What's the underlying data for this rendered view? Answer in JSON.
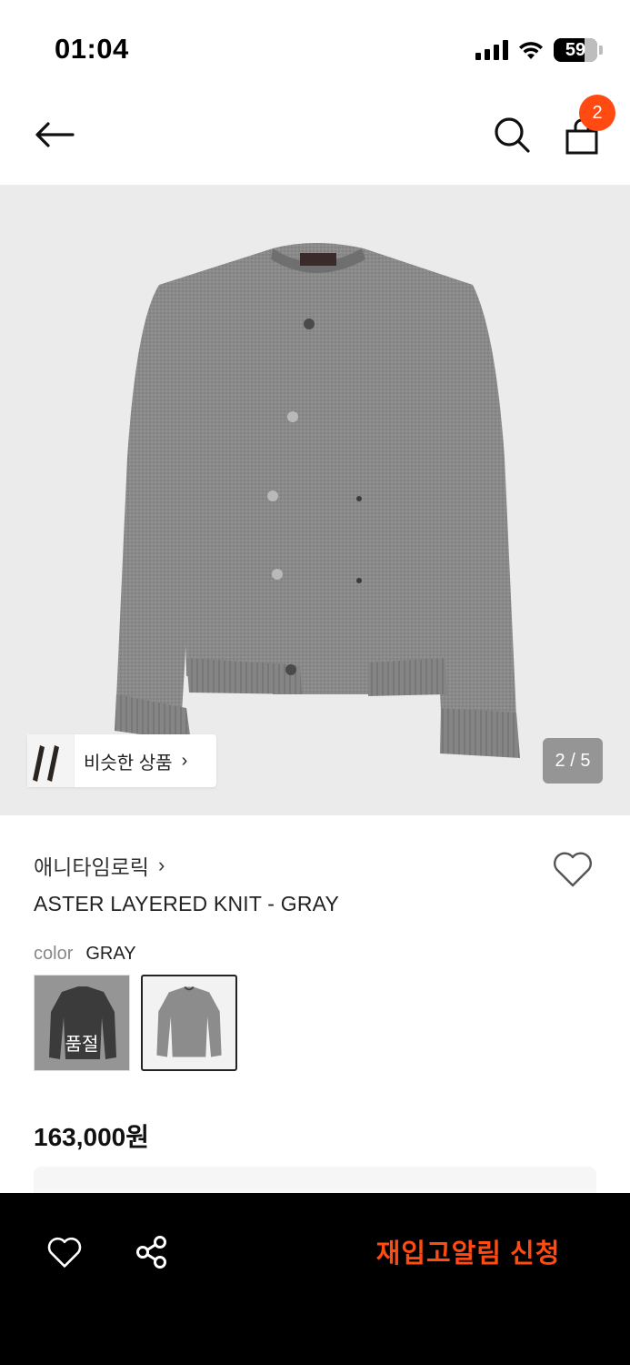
{
  "status_bar": {
    "time": "01:04",
    "battery": "59"
  },
  "nav": {
    "back_icon": "arrow-left-icon",
    "search_icon": "search-icon",
    "bag_icon": "shopping-bag-icon",
    "cart_count": "2"
  },
  "hero": {
    "image": "gray-layered-knit-cardigan",
    "similar_label": "비슷한 상품",
    "similar_chevron": "›",
    "page_indicator": "2 / 5"
  },
  "product": {
    "brand": "애니타임로릭",
    "brand_chevron": "›",
    "name": "ASTER LAYERED KNIT - GRAY",
    "color_label": "color",
    "color_value": "GRAY",
    "color_options": [
      {
        "name": "BLACK",
        "status": "품절"
      },
      {
        "name": "GRAY",
        "status": ""
      }
    ],
    "price": "163,000원"
  },
  "bottom_bar": {
    "like_icon": "heart-icon",
    "share_icon": "share-icon",
    "restock_label": "재입고알림 신청"
  },
  "colors": {
    "accent": "#ff4a12",
    "bottom_bar_bg": "#000000",
    "hero_bg": "#ebebeb"
  }
}
